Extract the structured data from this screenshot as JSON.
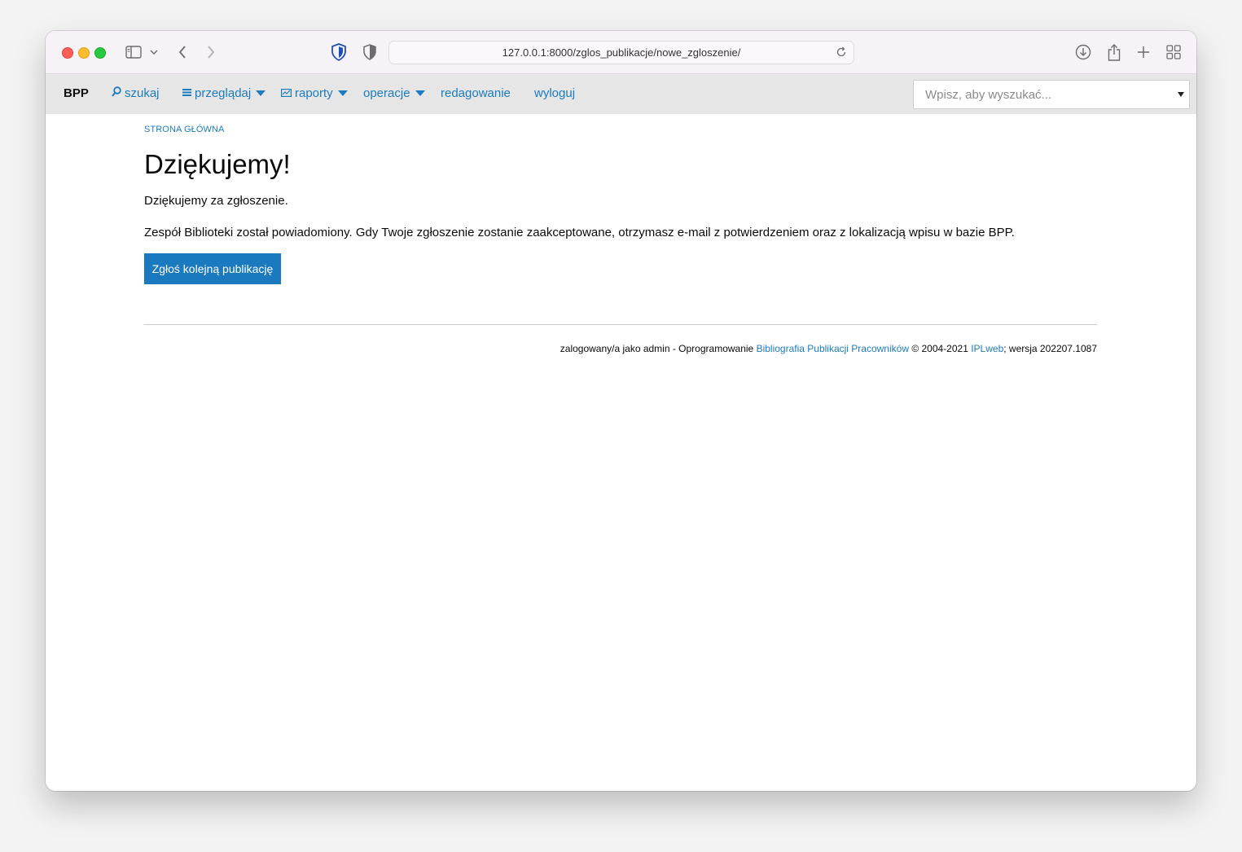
{
  "browser": {
    "url": "127.0.0.1:8000/zglos_publikacje/nowe_zgloszenie/"
  },
  "navbar": {
    "brand": "BPP",
    "items": [
      {
        "label": "szukaj",
        "icon": "search-icon"
      },
      {
        "label": "przeglądaj",
        "icon": "list-icon",
        "dropdown": true
      },
      {
        "label": "raporty",
        "icon": "chart-icon",
        "dropdown": true
      },
      {
        "label": "operacje",
        "dropdown": true
      },
      {
        "label": "redagowanie"
      },
      {
        "label": "wyloguj"
      }
    ],
    "search_placeholder": "Wpisz, aby wyszukać..."
  },
  "main": {
    "breadcrumb": "Strona główna",
    "title": "Dziękujemy!",
    "paragraph1": "Dziękujemy za zgłoszenie.",
    "paragraph2": "Zespół Biblioteki został powiadomiony. Gdy Twoje zgłoszenie zostanie zaakceptowane, otrzymasz e-mail z potwierdzeniem oraz z lokalizacją wpisu w bazie BPP.",
    "button_label": "Zgłoś kolejną publikację"
  },
  "footer": {
    "prefix": "zalogowany/a jako admin - Oprogramowanie ",
    "link1": "Bibliografia Publikacji Pracowników",
    "middle": " © 2004-2021 ",
    "link2": "IPLweb",
    "suffix": "; wersja 202207.1087"
  },
  "colors": {
    "accent": "#1b79bf",
    "navbar_bg": "#e6e6e6"
  }
}
